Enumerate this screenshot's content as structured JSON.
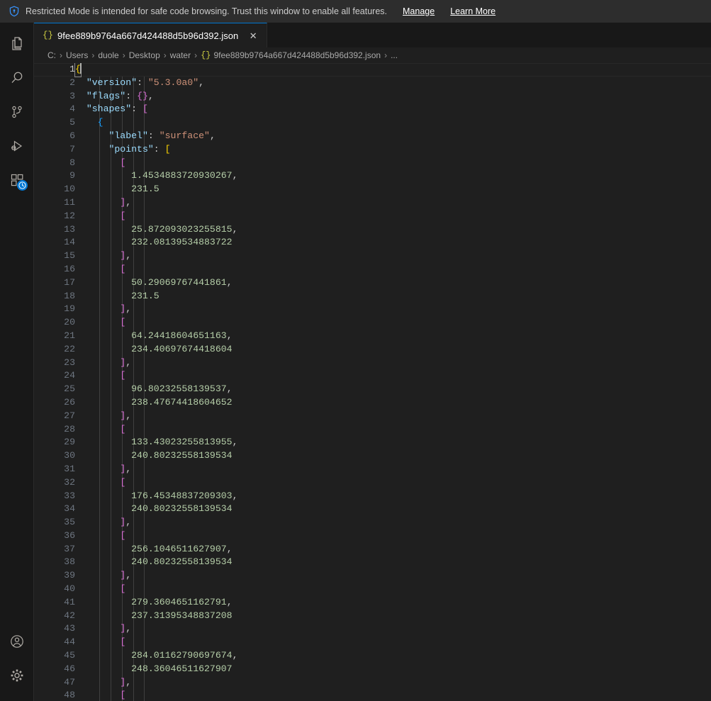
{
  "banner": {
    "icon": "shield-icon",
    "message": "Restricted Mode is intended for safe code browsing. Trust this window to enable all features.",
    "manage_label": "Manage",
    "learn_more_label": "Learn More"
  },
  "activity_bar": {
    "items": [
      {
        "name": "explorer",
        "icon": "files-icon"
      },
      {
        "name": "search",
        "icon": "search-icon"
      },
      {
        "name": "source-control",
        "icon": "source-control-icon"
      },
      {
        "name": "run-and-debug",
        "icon": "run-and-debug-icon"
      },
      {
        "name": "extensions",
        "icon": "extensions-icon",
        "badge_icon": "clock-icon"
      }
    ],
    "bottom_items": [
      {
        "name": "accounts",
        "icon": "account-icon"
      },
      {
        "name": "manage",
        "icon": "gear-icon"
      }
    ]
  },
  "tab": {
    "icon": "{}",
    "label": "9fee889b9764a667d424488d5b96d392.json",
    "close_glyph": "✕"
  },
  "breadcrumbs": {
    "separator": "›",
    "json_icon": "{}",
    "items": [
      "C:",
      "Users",
      "duole",
      "Desktop",
      "water"
    ],
    "file": "9fee889b9764a667d424488d5b96d392.json",
    "ellipsis": "..."
  },
  "editor": {
    "first_line": 1,
    "active_line": 1,
    "language": "json",
    "lines": [
      {
        "n": 1,
        "indent": 0,
        "tokens": [
          {
            "t": "b1",
            "v": "{"
          }
        ],
        "active": true,
        "caret": true
      },
      {
        "n": 2,
        "indent": 1,
        "tokens": [
          {
            "t": "key",
            "v": "\"version\""
          },
          {
            "t": "punc",
            "v": ": "
          },
          {
            "t": "str",
            "v": "\"5.3.0a0\""
          },
          {
            "t": "punc",
            "v": ","
          }
        ]
      },
      {
        "n": 3,
        "indent": 1,
        "tokens": [
          {
            "t": "key",
            "v": "\"flags\""
          },
          {
            "t": "punc",
            "v": ": "
          },
          {
            "t": "b2",
            "v": "{}"
          },
          {
            "t": "punc",
            "v": ","
          }
        ]
      },
      {
        "n": 4,
        "indent": 1,
        "tokens": [
          {
            "t": "key",
            "v": "\"shapes\""
          },
          {
            "t": "punc",
            "v": ": "
          },
          {
            "t": "b2",
            "v": "["
          }
        ]
      },
      {
        "n": 5,
        "indent": 2,
        "tokens": [
          {
            "t": "b3",
            "v": "{"
          }
        ]
      },
      {
        "n": 6,
        "indent": 3,
        "tokens": [
          {
            "t": "key",
            "v": "\"label\""
          },
          {
            "t": "punc",
            "v": ": "
          },
          {
            "t": "str",
            "v": "\"surface\""
          },
          {
            "t": "punc",
            "v": ","
          }
        ]
      },
      {
        "n": 7,
        "indent": 3,
        "tokens": [
          {
            "t": "key",
            "v": "\"points\""
          },
          {
            "t": "punc",
            "v": ": "
          },
          {
            "t": "b1",
            "v": "["
          }
        ]
      },
      {
        "n": 8,
        "indent": 4,
        "tokens": [
          {
            "t": "b2",
            "v": "["
          }
        ]
      },
      {
        "n": 9,
        "indent": 5,
        "tokens": [
          {
            "t": "num",
            "v": "1.4534883720930267"
          },
          {
            "t": "punc",
            "v": ","
          }
        ]
      },
      {
        "n": 10,
        "indent": 5,
        "tokens": [
          {
            "t": "num",
            "v": "231.5"
          }
        ]
      },
      {
        "n": 11,
        "indent": 4,
        "tokens": [
          {
            "t": "b2",
            "v": "]"
          },
          {
            "t": "punc",
            "v": ","
          }
        ]
      },
      {
        "n": 12,
        "indent": 4,
        "tokens": [
          {
            "t": "b2",
            "v": "["
          }
        ]
      },
      {
        "n": 13,
        "indent": 5,
        "tokens": [
          {
            "t": "num",
            "v": "25.872093023255815"
          },
          {
            "t": "punc",
            "v": ","
          }
        ]
      },
      {
        "n": 14,
        "indent": 5,
        "tokens": [
          {
            "t": "num",
            "v": "232.08139534883722"
          }
        ]
      },
      {
        "n": 15,
        "indent": 4,
        "tokens": [
          {
            "t": "b2",
            "v": "]"
          },
          {
            "t": "punc",
            "v": ","
          }
        ]
      },
      {
        "n": 16,
        "indent": 4,
        "tokens": [
          {
            "t": "b2",
            "v": "["
          }
        ]
      },
      {
        "n": 17,
        "indent": 5,
        "tokens": [
          {
            "t": "num",
            "v": "50.29069767441861"
          },
          {
            "t": "punc",
            "v": ","
          }
        ]
      },
      {
        "n": 18,
        "indent": 5,
        "tokens": [
          {
            "t": "num",
            "v": "231.5"
          }
        ]
      },
      {
        "n": 19,
        "indent": 4,
        "tokens": [
          {
            "t": "b2",
            "v": "]"
          },
          {
            "t": "punc",
            "v": ","
          }
        ]
      },
      {
        "n": 20,
        "indent": 4,
        "tokens": [
          {
            "t": "b2",
            "v": "["
          }
        ]
      },
      {
        "n": 21,
        "indent": 5,
        "tokens": [
          {
            "t": "num",
            "v": "64.24418604651163"
          },
          {
            "t": "punc",
            "v": ","
          }
        ]
      },
      {
        "n": 22,
        "indent": 5,
        "tokens": [
          {
            "t": "num",
            "v": "234.40697674418604"
          }
        ]
      },
      {
        "n": 23,
        "indent": 4,
        "tokens": [
          {
            "t": "b2",
            "v": "]"
          },
          {
            "t": "punc",
            "v": ","
          }
        ]
      },
      {
        "n": 24,
        "indent": 4,
        "tokens": [
          {
            "t": "b2",
            "v": "["
          }
        ]
      },
      {
        "n": 25,
        "indent": 5,
        "tokens": [
          {
            "t": "num",
            "v": "96.80232558139537"
          },
          {
            "t": "punc",
            "v": ","
          }
        ]
      },
      {
        "n": 26,
        "indent": 5,
        "tokens": [
          {
            "t": "num",
            "v": "238.47674418604652"
          }
        ]
      },
      {
        "n": 27,
        "indent": 4,
        "tokens": [
          {
            "t": "b2",
            "v": "]"
          },
          {
            "t": "punc",
            "v": ","
          }
        ]
      },
      {
        "n": 28,
        "indent": 4,
        "tokens": [
          {
            "t": "b2",
            "v": "["
          }
        ]
      },
      {
        "n": 29,
        "indent": 5,
        "tokens": [
          {
            "t": "num",
            "v": "133.43023255813955"
          },
          {
            "t": "punc",
            "v": ","
          }
        ]
      },
      {
        "n": 30,
        "indent": 5,
        "tokens": [
          {
            "t": "num",
            "v": "240.80232558139534"
          }
        ]
      },
      {
        "n": 31,
        "indent": 4,
        "tokens": [
          {
            "t": "b2",
            "v": "]"
          },
          {
            "t": "punc",
            "v": ","
          }
        ]
      },
      {
        "n": 32,
        "indent": 4,
        "tokens": [
          {
            "t": "b2",
            "v": "["
          }
        ]
      },
      {
        "n": 33,
        "indent": 5,
        "tokens": [
          {
            "t": "num",
            "v": "176.45348837209303"
          },
          {
            "t": "punc",
            "v": ","
          }
        ]
      },
      {
        "n": 34,
        "indent": 5,
        "tokens": [
          {
            "t": "num",
            "v": "240.80232558139534"
          }
        ]
      },
      {
        "n": 35,
        "indent": 4,
        "tokens": [
          {
            "t": "b2",
            "v": "]"
          },
          {
            "t": "punc",
            "v": ","
          }
        ]
      },
      {
        "n": 36,
        "indent": 4,
        "tokens": [
          {
            "t": "b2",
            "v": "["
          }
        ]
      },
      {
        "n": 37,
        "indent": 5,
        "tokens": [
          {
            "t": "num",
            "v": "256.1046511627907"
          },
          {
            "t": "punc",
            "v": ","
          }
        ]
      },
      {
        "n": 38,
        "indent": 5,
        "tokens": [
          {
            "t": "num",
            "v": "240.80232558139534"
          }
        ]
      },
      {
        "n": 39,
        "indent": 4,
        "tokens": [
          {
            "t": "b2",
            "v": "]"
          },
          {
            "t": "punc",
            "v": ","
          }
        ]
      },
      {
        "n": 40,
        "indent": 4,
        "tokens": [
          {
            "t": "b2",
            "v": "["
          }
        ]
      },
      {
        "n": 41,
        "indent": 5,
        "tokens": [
          {
            "t": "num",
            "v": "279.3604651162791"
          },
          {
            "t": "punc",
            "v": ","
          }
        ]
      },
      {
        "n": 42,
        "indent": 5,
        "tokens": [
          {
            "t": "num",
            "v": "237.31395348837208"
          }
        ]
      },
      {
        "n": 43,
        "indent": 4,
        "tokens": [
          {
            "t": "b2",
            "v": "]"
          },
          {
            "t": "punc",
            "v": ","
          }
        ]
      },
      {
        "n": 44,
        "indent": 4,
        "tokens": [
          {
            "t": "b2",
            "v": "["
          }
        ]
      },
      {
        "n": 45,
        "indent": 5,
        "tokens": [
          {
            "t": "num",
            "v": "284.01162790697674"
          },
          {
            "t": "punc",
            "v": ","
          }
        ]
      },
      {
        "n": 46,
        "indent": 5,
        "tokens": [
          {
            "t": "num",
            "v": "248.36046511627907"
          }
        ]
      },
      {
        "n": 47,
        "indent": 4,
        "tokens": [
          {
            "t": "b2",
            "v": "]"
          },
          {
            "t": "punc",
            "v": ","
          }
        ]
      },
      {
        "n": 48,
        "indent": 4,
        "tokens": [
          {
            "t": "b2",
            "v": "["
          }
        ]
      }
    ]
  },
  "colors": {
    "accent": "#0078d4",
    "editor_bg": "#1f1f1f",
    "activitybar_bg": "#181818",
    "banner_bg": "#2d2d2d",
    "key": "#9cdcfe",
    "string": "#ce9178",
    "number": "#b5cea8",
    "bracket1": "#ffd700",
    "bracket2": "#da70d6",
    "bracket3": "#179fff",
    "line_number": "#6e7681"
  }
}
